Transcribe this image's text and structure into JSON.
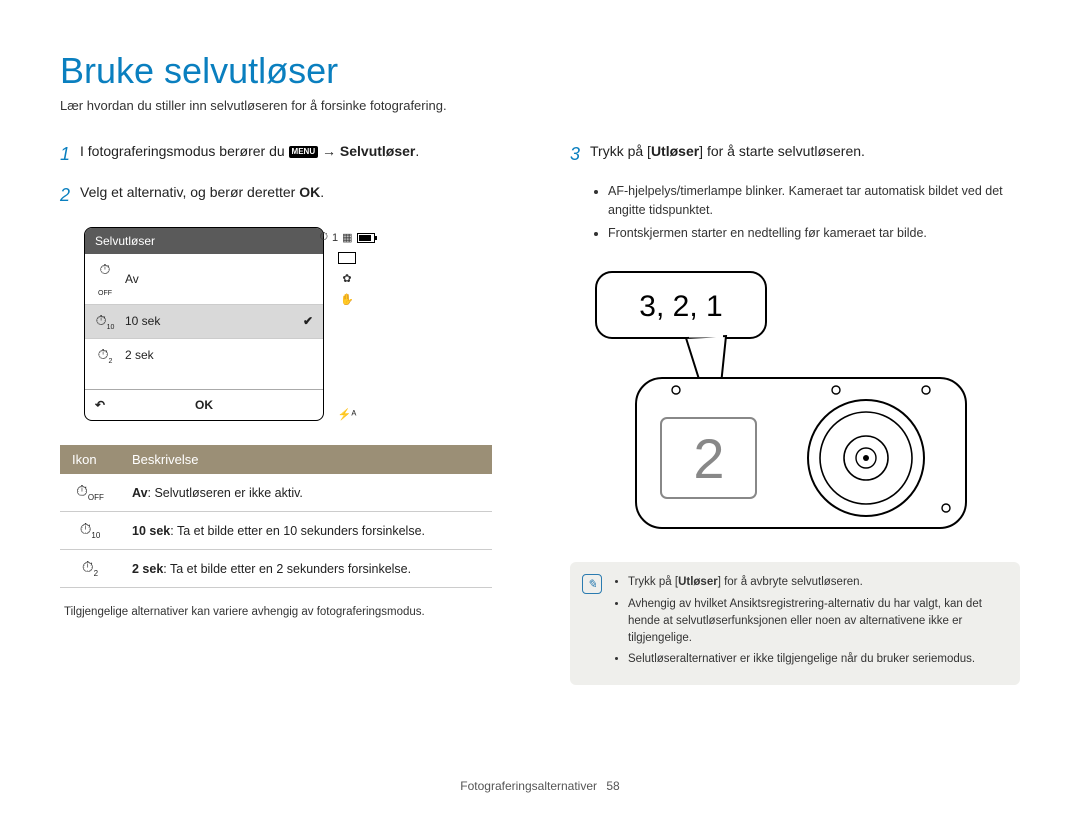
{
  "title": "Bruke selvutløser",
  "subtitle": "Lær hvordan du stiller inn selvutløseren for å forsinke fotografering.",
  "left": {
    "step1": {
      "pre": "I fotograferingsmodus berører du ",
      "menu_label": "MENU",
      "arrow": " → ",
      "bold": "Selvutløser",
      "post": "."
    },
    "step2": {
      "text": "Velg et alternativ, og berør deretter ",
      "ok": "OK",
      "post": "."
    },
    "menu": {
      "header": "Selvutløser",
      "rows": [
        {
          "icon": "⏱",
          "sub": "OFF",
          "label": "Av",
          "selected": false,
          "checked": false
        },
        {
          "icon": "⏱",
          "sub": "10",
          "label": "10 sek",
          "selected": true,
          "checked": true
        },
        {
          "icon": "⏱",
          "sub": "2",
          "label": "2 sek",
          "selected": false,
          "checked": false
        }
      ],
      "footer_back": "↶",
      "footer_ok": "OK",
      "side_top_num": "1",
      "side_flash": "⚡ᴬ"
    },
    "table": {
      "head_icon": "Ikon",
      "head_desc": "Beskrivelse",
      "rows": [
        {
          "icon": "⏱",
          "sub": "OFF",
          "bold": "Av",
          "rest": ": Selvutløseren er ikke aktiv."
        },
        {
          "icon": "⏱",
          "sub": "10",
          "bold": "10 sek",
          "rest": ": Ta et bilde etter en 10 sekunders forsinkelse."
        },
        {
          "icon": "⏱",
          "sub": "2",
          "bold": "2 sek",
          "rest": ": Ta et bilde etter en 2 sekunders forsinkelse."
        }
      ]
    },
    "footnote": "Tilgjengelige alternativer kan variere avhengig av fotograferingsmodus."
  },
  "right": {
    "step3": {
      "pre": "Trykk på [",
      "bold": "Utløser",
      "post": "] for å starte selvutløseren."
    },
    "bullets": [
      "AF-hjelpelys/timerlampe blinker. Kameraet tar automatisk bildet ved det angitte tidspunktet.",
      "Frontskjermen starter en nedtelling før kameraet tar bilde."
    ],
    "bubble_text": "3, 2, 1",
    "front_screen_num": "2",
    "info": {
      "items": [
        {
          "pre": "Trykk på [",
          "bold": "Utløser",
          "post": "] for å avbryte selvutløseren."
        },
        {
          "text": "Avhengig av hvilket Ansiktsregistrering-alternativ du har valgt, kan det hende at selvutløserfunksjonen eller noen av alternativene ikke er tilgjengelige."
        },
        {
          "text": "Selutløseralternativer er ikke tilgjengelige når du bruker seriemodus."
        }
      ]
    }
  },
  "footer": {
    "section": "Fotograferingsalternativer",
    "page": "58"
  }
}
